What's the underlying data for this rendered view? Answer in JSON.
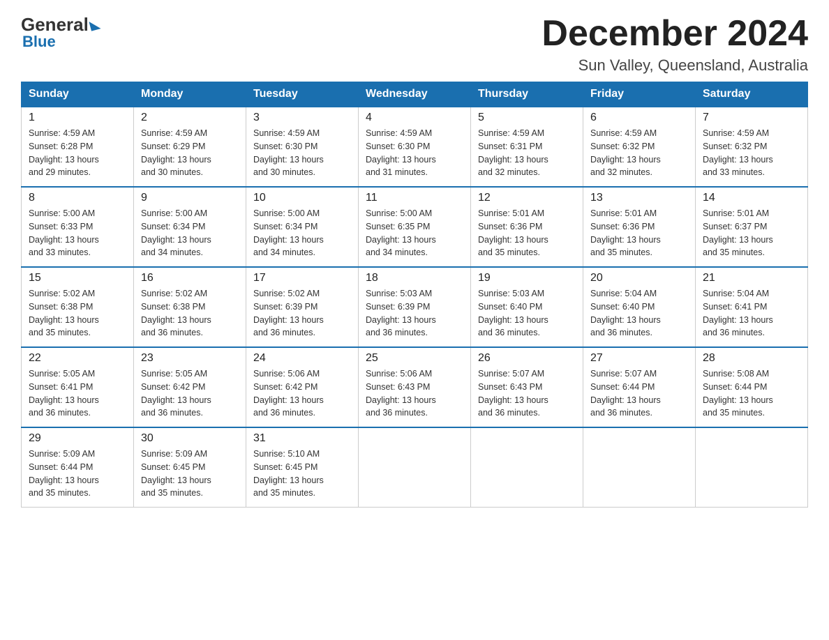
{
  "logo": {
    "general": "General",
    "blue": "Blue"
  },
  "header": {
    "title": "December 2024",
    "subtitle": "Sun Valley, Queensland, Australia"
  },
  "days_of_week": [
    "Sunday",
    "Monday",
    "Tuesday",
    "Wednesday",
    "Thursday",
    "Friday",
    "Saturday"
  ],
  "weeks": [
    [
      {
        "day": 1,
        "sunrise": "4:59 AM",
        "sunset": "6:28 PM",
        "daylight": "13 hours and 29 minutes."
      },
      {
        "day": 2,
        "sunrise": "4:59 AM",
        "sunset": "6:29 PM",
        "daylight": "13 hours and 30 minutes."
      },
      {
        "day": 3,
        "sunrise": "4:59 AM",
        "sunset": "6:30 PM",
        "daylight": "13 hours and 30 minutes."
      },
      {
        "day": 4,
        "sunrise": "4:59 AM",
        "sunset": "6:30 PM",
        "daylight": "13 hours and 31 minutes."
      },
      {
        "day": 5,
        "sunrise": "4:59 AM",
        "sunset": "6:31 PM",
        "daylight": "13 hours and 32 minutes."
      },
      {
        "day": 6,
        "sunrise": "4:59 AM",
        "sunset": "6:32 PM",
        "daylight": "13 hours and 32 minutes."
      },
      {
        "day": 7,
        "sunrise": "4:59 AM",
        "sunset": "6:32 PM",
        "daylight": "13 hours and 33 minutes."
      }
    ],
    [
      {
        "day": 8,
        "sunrise": "5:00 AM",
        "sunset": "6:33 PM",
        "daylight": "13 hours and 33 minutes."
      },
      {
        "day": 9,
        "sunrise": "5:00 AM",
        "sunset": "6:34 PM",
        "daylight": "13 hours and 34 minutes."
      },
      {
        "day": 10,
        "sunrise": "5:00 AM",
        "sunset": "6:34 PM",
        "daylight": "13 hours and 34 minutes."
      },
      {
        "day": 11,
        "sunrise": "5:00 AM",
        "sunset": "6:35 PM",
        "daylight": "13 hours and 34 minutes."
      },
      {
        "day": 12,
        "sunrise": "5:01 AM",
        "sunset": "6:36 PM",
        "daylight": "13 hours and 35 minutes."
      },
      {
        "day": 13,
        "sunrise": "5:01 AM",
        "sunset": "6:36 PM",
        "daylight": "13 hours and 35 minutes."
      },
      {
        "day": 14,
        "sunrise": "5:01 AM",
        "sunset": "6:37 PM",
        "daylight": "13 hours and 35 minutes."
      }
    ],
    [
      {
        "day": 15,
        "sunrise": "5:02 AM",
        "sunset": "6:38 PM",
        "daylight": "13 hours and 35 minutes."
      },
      {
        "day": 16,
        "sunrise": "5:02 AM",
        "sunset": "6:38 PM",
        "daylight": "13 hours and 36 minutes."
      },
      {
        "day": 17,
        "sunrise": "5:02 AM",
        "sunset": "6:39 PM",
        "daylight": "13 hours and 36 minutes."
      },
      {
        "day": 18,
        "sunrise": "5:03 AM",
        "sunset": "6:39 PM",
        "daylight": "13 hours and 36 minutes."
      },
      {
        "day": 19,
        "sunrise": "5:03 AM",
        "sunset": "6:40 PM",
        "daylight": "13 hours and 36 minutes."
      },
      {
        "day": 20,
        "sunrise": "5:04 AM",
        "sunset": "6:40 PM",
        "daylight": "13 hours and 36 minutes."
      },
      {
        "day": 21,
        "sunrise": "5:04 AM",
        "sunset": "6:41 PM",
        "daylight": "13 hours and 36 minutes."
      }
    ],
    [
      {
        "day": 22,
        "sunrise": "5:05 AM",
        "sunset": "6:41 PM",
        "daylight": "13 hours and 36 minutes."
      },
      {
        "day": 23,
        "sunrise": "5:05 AM",
        "sunset": "6:42 PM",
        "daylight": "13 hours and 36 minutes."
      },
      {
        "day": 24,
        "sunrise": "5:06 AM",
        "sunset": "6:42 PM",
        "daylight": "13 hours and 36 minutes."
      },
      {
        "day": 25,
        "sunrise": "5:06 AM",
        "sunset": "6:43 PM",
        "daylight": "13 hours and 36 minutes."
      },
      {
        "day": 26,
        "sunrise": "5:07 AM",
        "sunset": "6:43 PM",
        "daylight": "13 hours and 36 minutes."
      },
      {
        "day": 27,
        "sunrise": "5:07 AM",
        "sunset": "6:44 PM",
        "daylight": "13 hours and 36 minutes."
      },
      {
        "day": 28,
        "sunrise": "5:08 AM",
        "sunset": "6:44 PM",
        "daylight": "13 hours and 35 minutes."
      }
    ],
    [
      {
        "day": 29,
        "sunrise": "5:09 AM",
        "sunset": "6:44 PM",
        "daylight": "13 hours and 35 minutes."
      },
      {
        "day": 30,
        "sunrise": "5:09 AM",
        "sunset": "6:45 PM",
        "daylight": "13 hours and 35 minutes."
      },
      {
        "day": 31,
        "sunrise": "5:10 AM",
        "sunset": "6:45 PM",
        "daylight": "13 hours and 35 minutes."
      },
      null,
      null,
      null,
      null
    ]
  ],
  "labels": {
    "sunrise": "Sunrise:",
    "sunset": "Sunset:",
    "daylight": "Daylight:"
  }
}
